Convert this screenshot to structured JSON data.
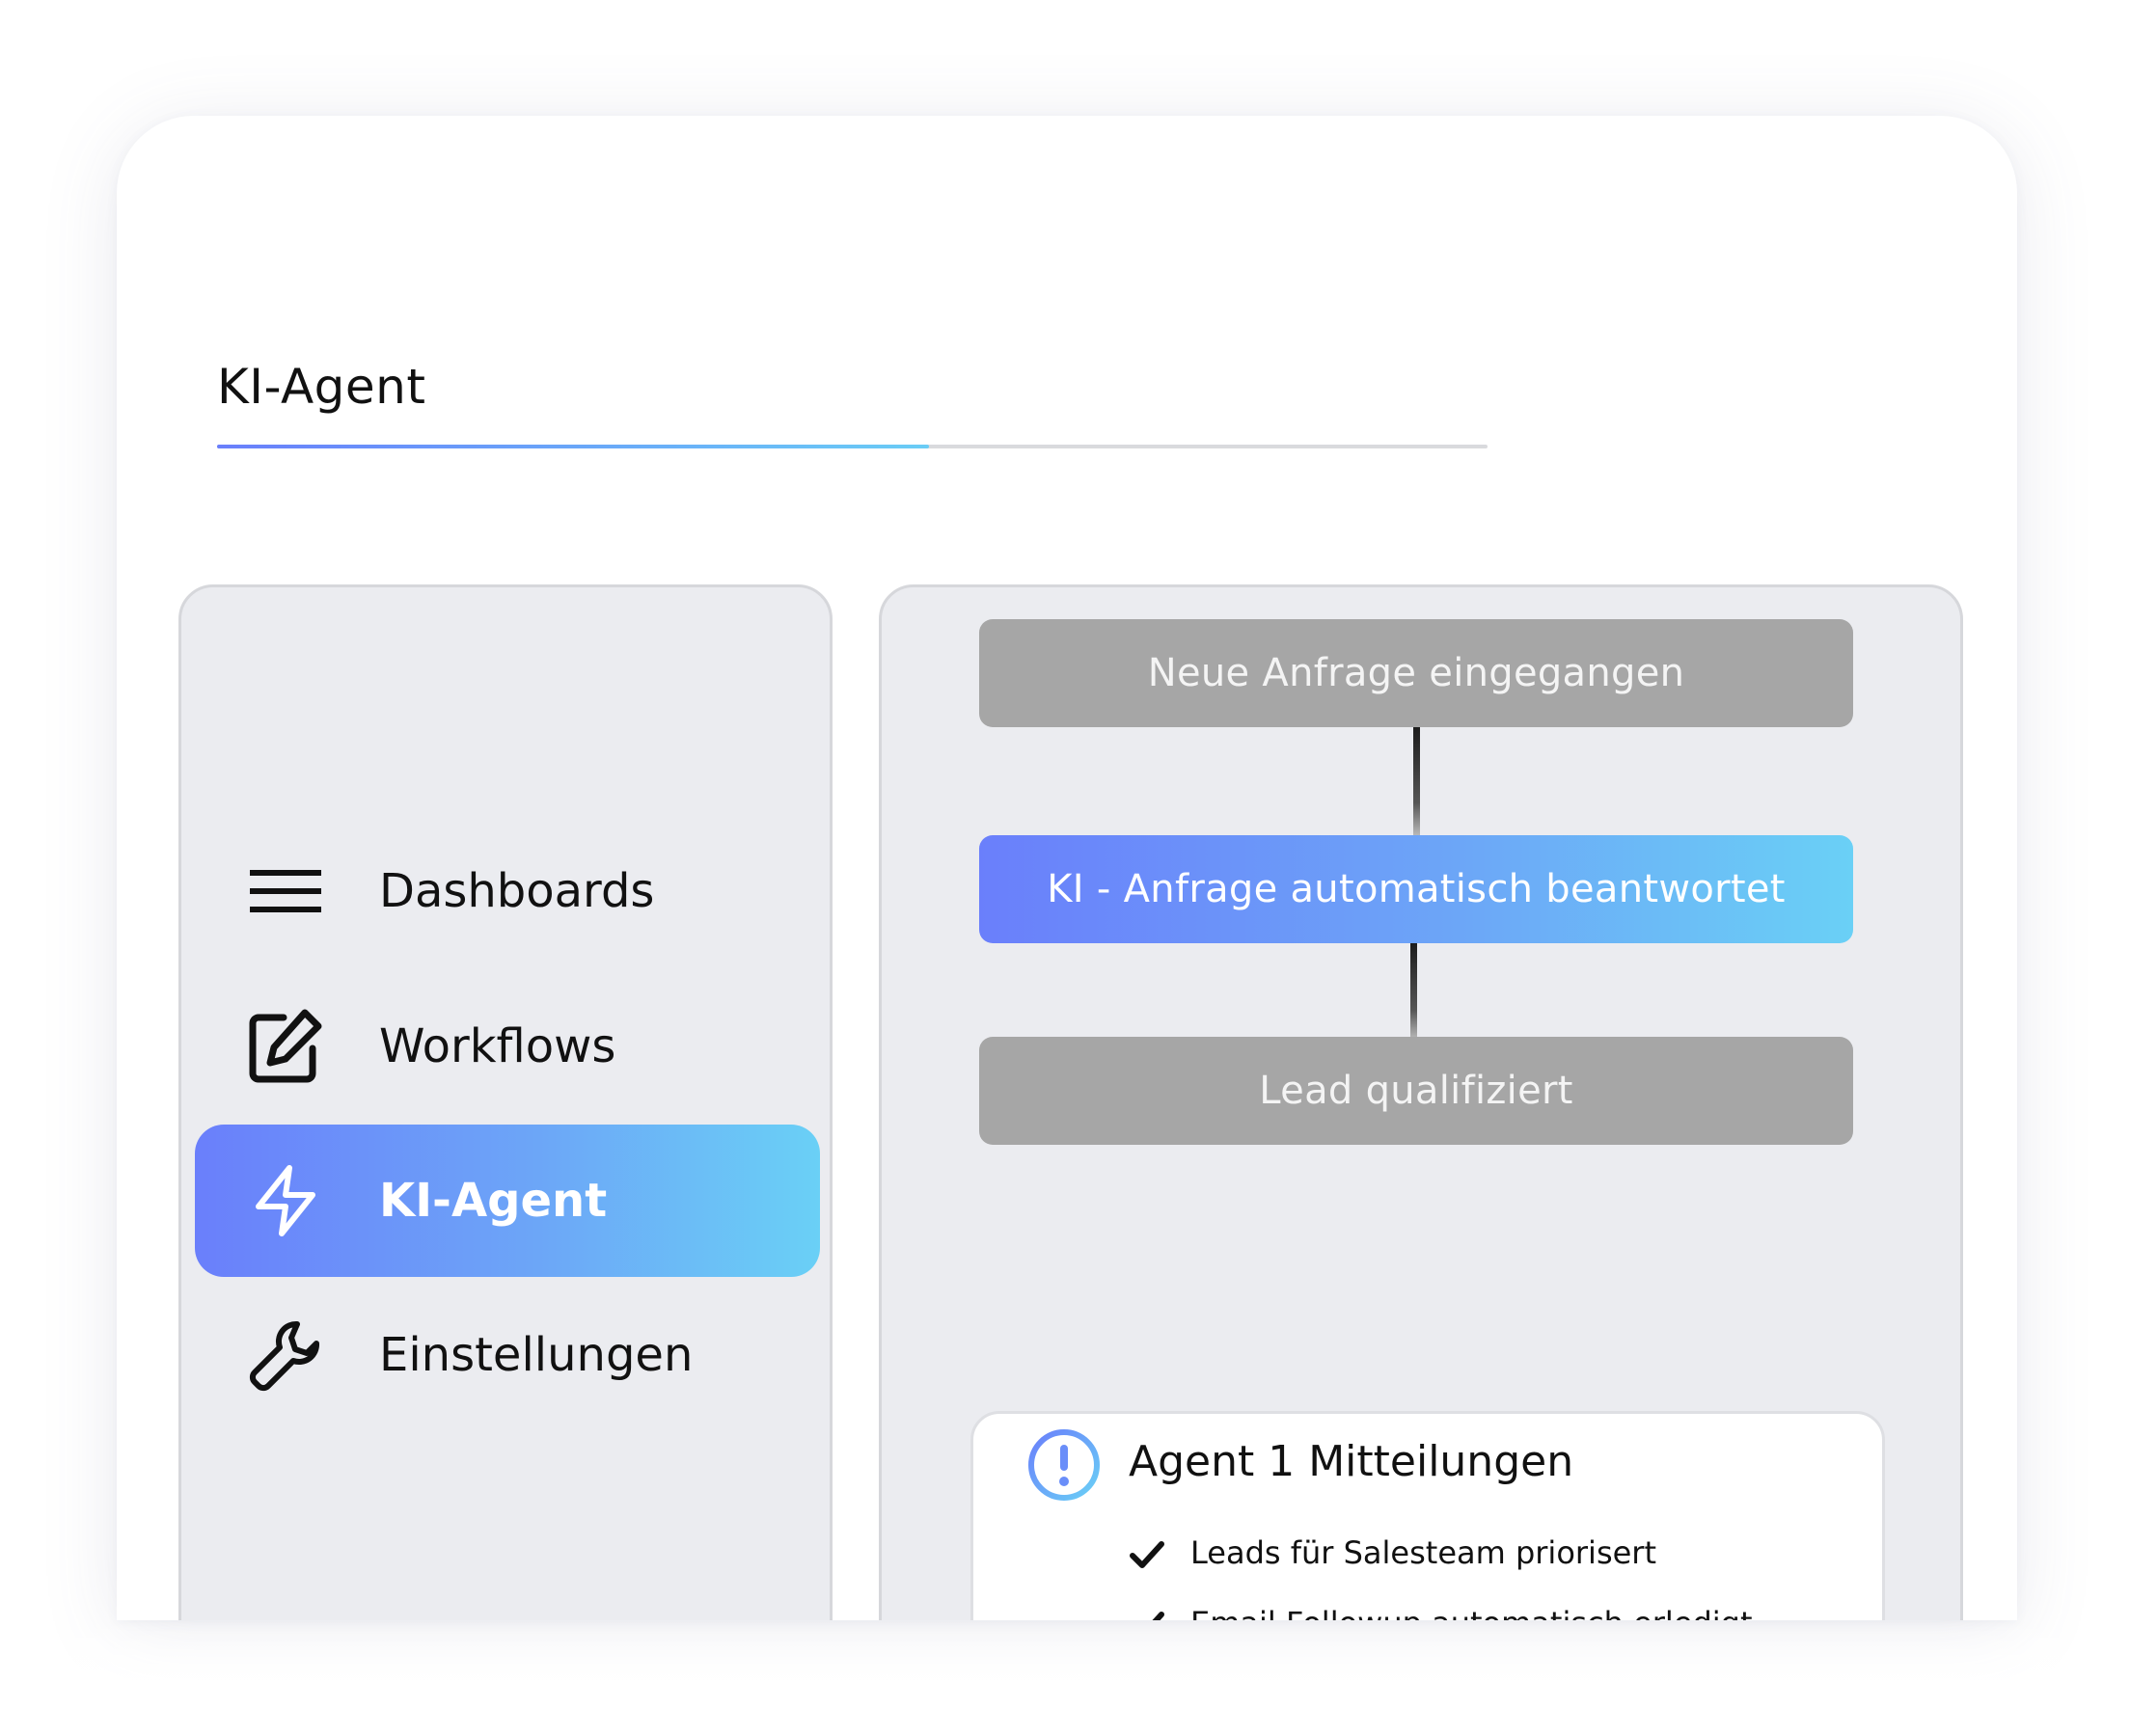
{
  "page": {
    "title": "KI-Agent",
    "tab_progress_fraction": 0.56
  },
  "sidebar": {
    "items": [
      {
        "label": "Dashboards",
        "icon": "menu-icon",
        "active": false
      },
      {
        "label": "Workflows",
        "icon": "edit-icon",
        "active": false
      },
      {
        "label": "KI-Agent",
        "icon": "lightning-icon",
        "active": true
      },
      {
        "label": "Einstellungen",
        "icon": "wrench-icon",
        "active": false
      }
    ]
  },
  "workflow": {
    "steps": [
      {
        "label": "Neue Anfrage eingegangen",
        "highlighted": false
      },
      {
        "label": "KI - Anfrage automatisch beantwortet",
        "highlighted": true
      },
      {
        "label": "Lead qualifiziert",
        "highlighted": false
      }
    ]
  },
  "notifications": {
    "title": "Agent 1 Mitteilungen",
    "icon": "alert-circle-icon",
    "items": [
      {
        "text": "Leads für Salesteam priorisert",
        "icon": "check-icon"
      },
      {
        "text": "Email Followup automatisch erledigt",
        "icon": "check-icon"
      }
    ]
  },
  "colors": {
    "accent_start": "#6a7ffb",
    "accent_end": "#6ad0f6",
    "panel_background": "#ebecf0",
    "step_inactive": "#a6a6a6"
  }
}
